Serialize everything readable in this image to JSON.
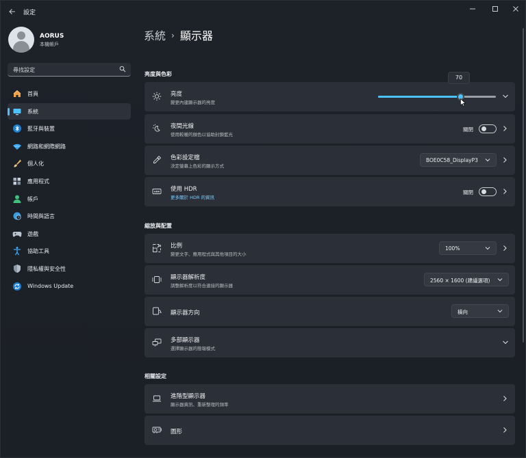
{
  "window": {
    "title": "設定"
  },
  "profile": {
    "name": "AORUS",
    "account_type": "本機帳戶"
  },
  "search": {
    "placeholder": "尋找設定"
  },
  "sidebar": {
    "items": [
      {
        "label": "首頁",
        "icon": "home-icon"
      },
      {
        "label": "系統",
        "icon": "system-icon",
        "active": true
      },
      {
        "label": "藍牙與裝置",
        "icon": "bluetooth-icon"
      },
      {
        "label": "網路和網際網路",
        "icon": "wifi-icon"
      },
      {
        "label": "個人化",
        "icon": "brush-icon"
      },
      {
        "label": "應用程式",
        "icon": "apps-icon"
      },
      {
        "label": "帳戶",
        "icon": "account-icon"
      },
      {
        "label": "時間與語言",
        "icon": "clock-globe-icon"
      },
      {
        "label": "遊戲",
        "icon": "gamepad-icon"
      },
      {
        "label": "協助工具",
        "icon": "accessibility-icon"
      },
      {
        "label": "隱私權與安全性",
        "icon": "shield-icon"
      },
      {
        "label": "Windows Update",
        "icon": "update-icon"
      }
    ]
  },
  "breadcrumb": {
    "parent": "系統",
    "separator": "›",
    "current": "顯示器"
  },
  "sections": {
    "brightness_color": "亮度與色彩",
    "scale_layout": "縮放與配置",
    "related": "相關設定"
  },
  "cards": {
    "brightness": {
      "title": "亮度",
      "subtitle": "變更內建顯示器的亮度",
      "value": 70,
      "value_label": "70"
    },
    "night_light": {
      "title": "夜間光線",
      "subtitle": "使用較暖的顏色以協助封鎖藍光",
      "state": "關閉"
    },
    "color_profile": {
      "title": "色彩設定檔",
      "subtitle": "決定螢幕上色彩的顯示方式",
      "selected": "BOE0C58_DisplayP3"
    },
    "hdr": {
      "title": "使用 HDR",
      "subtitle": "更多關於 HDR 的資訊",
      "state": "關閉"
    },
    "scale": {
      "title": "比例",
      "subtitle": "變更文字、應用程式與其他項目的大小",
      "selected": "100%"
    },
    "resolution": {
      "title": "顯示器解析度",
      "subtitle": "調整解析度以符合連接的顯示器",
      "selected": "2560 × 1600 (建議選項)"
    },
    "orientation": {
      "title": "顯示器方向",
      "selected": "橫向"
    },
    "multiple_displays": {
      "title": "多部顯示器",
      "subtitle": "選擇顯示器的簡報模式"
    },
    "advanced_display": {
      "title": "進階型顯示器",
      "subtitle": "顯示器資訊、重新整理的頻率"
    },
    "graphics": {
      "title": "圖形"
    }
  },
  "colors": {
    "accent": "#4cc2ff",
    "background": "#1c2027",
    "card": "#2b2f37"
  }
}
